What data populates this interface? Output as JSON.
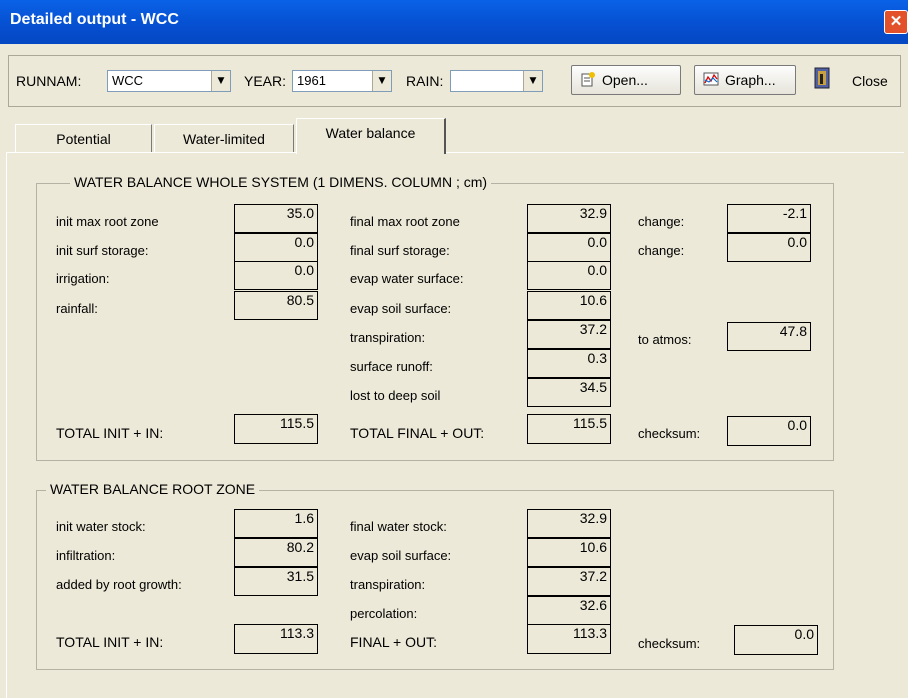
{
  "window": {
    "title": "Detailed output - WCC",
    "close_glyph": "✕"
  },
  "toolbar": {
    "runnam_label": "RUNNAM:",
    "runnam_value": "WCC",
    "year_label": "YEAR:",
    "year_value": "1961",
    "rain_label": "RAIN:",
    "rain_value": "",
    "open_label": "Open...",
    "graph_label": "Graph...",
    "close_label": "Close"
  },
  "tabs": [
    {
      "label": "Potential",
      "active": false
    },
    {
      "label": "Water-limited",
      "active": false
    },
    {
      "label": "Water balance",
      "active": true
    }
  ],
  "whole_system": {
    "title": "WATER BALANCE WHOLE SYSTEM (1 DIMENS. COLUMN ; cm)",
    "left": [
      {
        "label": "init max root zone",
        "value": "35.0"
      },
      {
        "label": "init surf storage:",
        "value": "0.0"
      },
      {
        "label": "irrigation:",
        "value": "0.0"
      },
      {
        "label": "rainfall:",
        "value": "80.5"
      }
    ],
    "middle": [
      {
        "label": "final max root zone",
        "value": "32.9"
      },
      {
        "label": "final surf storage:",
        "value": "0.0"
      },
      {
        "label": "evap water surface:",
        "value": "0.0"
      },
      {
        "label": "evap soil surface:",
        "value": "10.6"
      },
      {
        "label": "transpiration:",
        "value": "37.2"
      },
      {
        "label": "surface runoff:",
        "value": "0.3"
      },
      {
        "label": "lost to deep soil",
        "value": "34.5"
      }
    ],
    "right": [
      {
        "label": "change:",
        "value": "-2.1"
      },
      {
        "label": "change:",
        "value": "0.0"
      },
      {
        "label": "to atmos:",
        "value": "47.8"
      }
    ],
    "total_in_label": "TOTAL INIT + IN:",
    "total_in_value": "115.5",
    "total_out_label": "TOTAL FINAL + OUT:",
    "total_out_value": "115.5",
    "checksum_label": "checksum:",
    "checksum_value": "0.0"
  },
  "root_zone": {
    "title": "WATER BALANCE ROOT ZONE",
    "left": [
      {
        "label": "init water stock:",
        "value": "1.6"
      },
      {
        "label": "infiltration:",
        "value": "80.2"
      },
      {
        "label": "added by root growth:",
        "value": "31.5"
      }
    ],
    "middle": [
      {
        "label": "final water stock:",
        "value": "32.9"
      },
      {
        "label": "evap soil surface:",
        "value": "10.6"
      },
      {
        "label": "transpiration:",
        "value": "37.2"
      },
      {
        "label": "percolation:",
        "value": "32.6"
      }
    ],
    "total_in_label": "TOTAL INIT + IN:",
    "total_in_value": "113.3",
    "total_out_label": "FINAL + OUT:",
    "total_out_value": "113.3",
    "checksum_label": "checksum:",
    "checksum_value": "0.0"
  }
}
